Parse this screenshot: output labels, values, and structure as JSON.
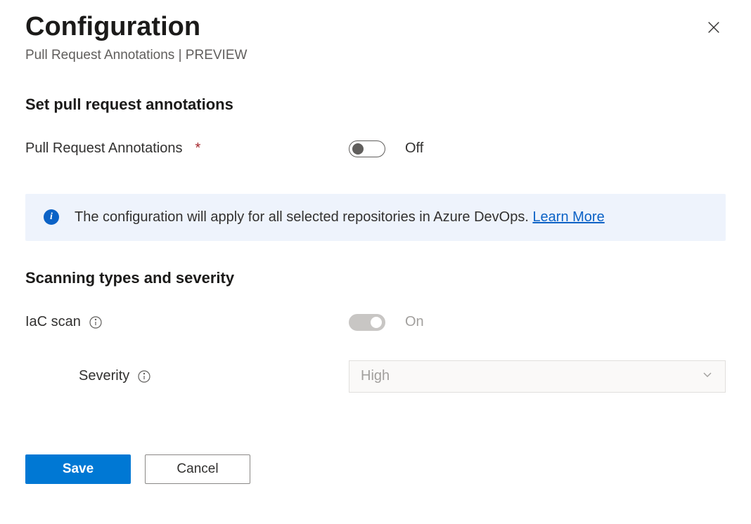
{
  "header": {
    "title": "Configuration",
    "subtitle": "Pull Request Annotations | PREVIEW"
  },
  "section1": {
    "heading": "Set pull request annotations",
    "pr_annotations_label": "Pull Request Annotations",
    "pr_annotations_state": "Off"
  },
  "banner": {
    "text": "The configuration will apply for all selected repositories in Azure DevOps. ",
    "link_text": "Learn More"
  },
  "section2": {
    "heading": "Scanning types and severity",
    "iac_label": "IaC scan",
    "iac_state": "On",
    "severity_label": "Severity",
    "severity_value": "High"
  },
  "footer": {
    "save": "Save",
    "cancel": "Cancel"
  }
}
